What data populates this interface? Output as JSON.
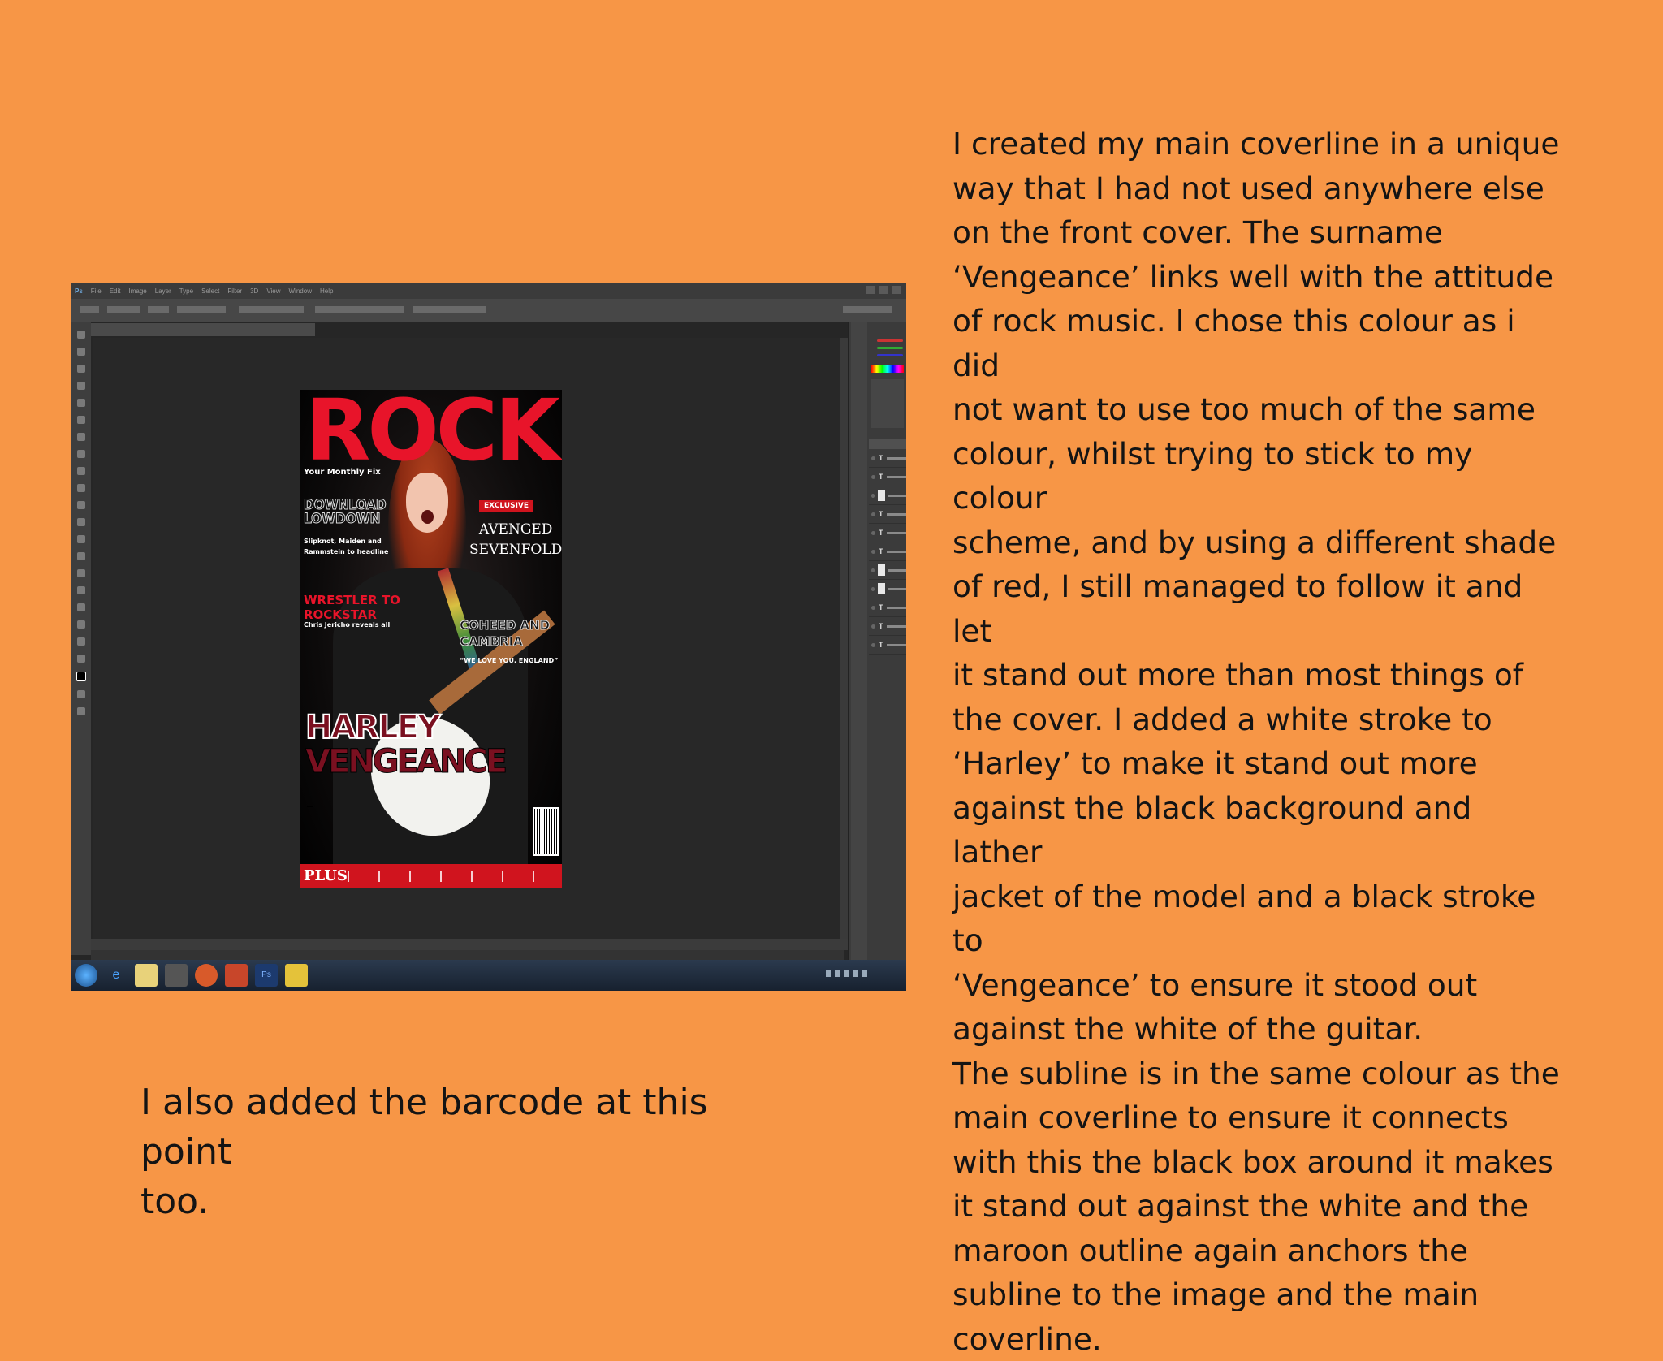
{
  "slide": {
    "right_text": "I created my main coverline in a unique\nway that I had not used anywhere else\non the front cover. The surname\n‘Vengeance’ links well with the attitude\nof rock music. I chose this colour as i did\nnot want to use too much of the same\ncolour, whilst trying to stick to my colour\nscheme, and by using a different shade\nof red, I still managed to follow it and let\nit stand out more than most things of\nthe cover. I added a white stroke to\n‘Harley’ to make it stand out more\nagainst the black background and lather\njacket of the model and a black stroke to\n‘Vengeance’ to ensure it stood out\nagainst the white of the guitar.\nThe subline is in the same colour as the\nmain coverline to ensure it connects\nwith this the black box around it makes\nit stand out against the white and the\nmaroon outline again anchors the\nsubline to the image and the main\ncoverline.",
    "bottom_text": "I also added the barcode at this point\ntoo."
  },
  "photoshop": {
    "menu": [
      "Ps",
      "File",
      "Edit",
      "Image",
      "Layer",
      "Type",
      "Select",
      "Filter",
      "3D",
      "View",
      "Window",
      "Help"
    ],
    "layers": [
      {
        "type": "T"
      },
      {
        "type": "T"
      },
      {
        "type": "shape"
      },
      {
        "type": "T"
      },
      {
        "type": "T"
      },
      {
        "type": "T"
      },
      {
        "type": "image"
      },
      {
        "type": "image"
      },
      {
        "type": "T"
      },
      {
        "type": "T"
      },
      {
        "type": "T"
      }
    ]
  },
  "cover": {
    "masthead": "ROCK",
    "tagline": "Your Monthly Fix",
    "download": "DOWNLOAD\nLOWDOWN",
    "slip": "Slipknot, Maiden and\nRammstein to headline",
    "exclusive": "EXCLUSIVE",
    "avenged": "AVENGED\nSEVENFOLD",
    "wrestler": "WRESTLER TO\nROCKSTAR",
    "jericho": "Chris Jericho reveals all",
    "coheed": "COHEED AND\nCAMBRIA",
    "quote": "“WE LOVE YOU, ENGLAND”",
    "harley": "HARLEY",
    "vengeance": "VENGEANCE",
    "plus": "PLUS"
  },
  "colors": {
    "background": "#F79646",
    "masthead_red": "#e8142a",
    "coverline_maroon": "#7a1020"
  }
}
